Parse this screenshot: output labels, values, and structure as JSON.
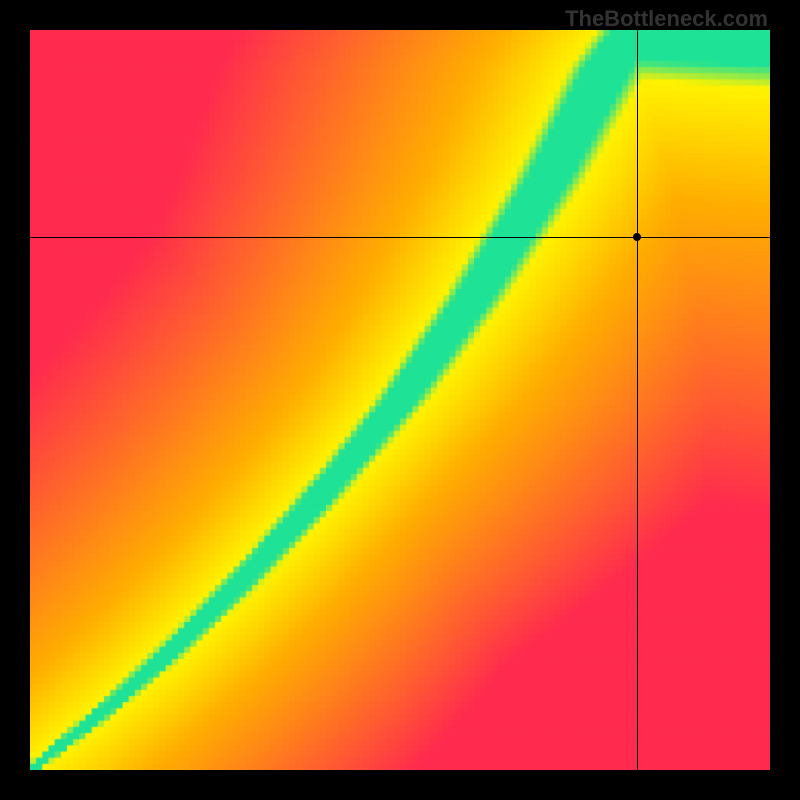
{
  "watermark": "TheBottleneck.com",
  "chart_data": {
    "type": "heatmap",
    "title": "",
    "xlabel": "",
    "ylabel": "",
    "xlim": [
      0,
      100
    ],
    "ylim": [
      0,
      100
    ],
    "marker": {
      "x": 82,
      "y": 72
    },
    "crosshair": {
      "x": 82,
      "y": 72
    },
    "optimal_ridge": [
      {
        "x": 0,
        "y": 0
      },
      {
        "x": 10,
        "y": 8
      },
      {
        "x": 20,
        "y": 17
      },
      {
        "x": 30,
        "y": 27
      },
      {
        "x": 40,
        "y": 38
      },
      {
        "x": 50,
        "y": 50
      },
      {
        "x": 60,
        "y": 64
      },
      {
        "x": 70,
        "y": 80
      },
      {
        "x": 78,
        "y": 95
      },
      {
        "x": 82,
        "y": 100
      }
    ],
    "color_scale": {
      "optimal": "#1ee296",
      "near": "#fff200",
      "mid": "#ffae00",
      "far": "#ff2b4e"
    },
    "grid_resolution": 120
  }
}
